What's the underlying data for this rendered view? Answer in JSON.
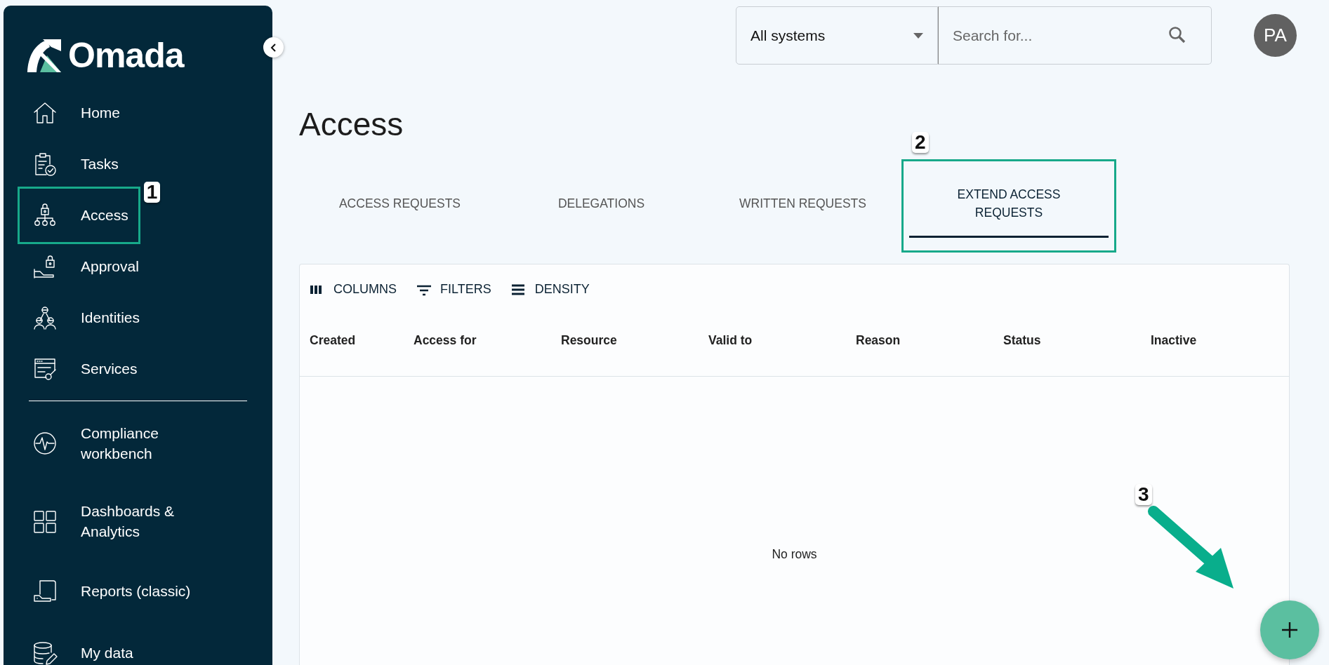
{
  "brand": {
    "name": "Omada"
  },
  "sidebar": {
    "groups": [
      {
        "items": [
          {
            "label": "Home",
            "highlighted": false
          },
          {
            "label": "Tasks",
            "highlighted": false
          },
          {
            "label": "Access",
            "highlighted": true,
            "callout": "1"
          },
          {
            "label": "Approval",
            "highlighted": false
          },
          {
            "label": "Identities",
            "highlighted": false
          },
          {
            "label": "Services",
            "highlighted": false
          }
        ]
      },
      {
        "items": [
          {
            "label": "Compliance workbench",
            "highlighted": false
          },
          {
            "label": "Dashboards & Analytics",
            "highlighted": false
          },
          {
            "label": "Reports (classic)",
            "highlighted": false
          },
          {
            "label": "My data",
            "highlighted": false
          }
        ]
      }
    ]
  },
  "top_bar": {
    "system_select": {
      "value": "All systems"
    },
    "search": {
      "placeholder": "Search for..."
    },
    "avatar": {
      "initials": "PA"
    }
  },
  "page": {
    "title": "Access"
  },
  "tabs": [
    {
      "label": "ACCESS REQUESTS",
      "selected": false,
      "highlighted": false
    },
    {
      "label": "DELEGATIONS",
      "selected": false,
      "highlighted": false
    },
    {
      "label": "WRITTEN REQUESTS",
      "selected": false,
      "highlighted": false
    },
    {
      "label": "EXTEND ACCESS REQUESTS",
      "selected": true,
      "highlighted": true,
      "callout": "2"
    }
  ],
  "table": {
    "toolbar": [
      {
        "label": "COLUMNS"
      },
      {
        "label": "FILTERS"
      },
      {
        "label": "DENSITY"
      }
    ],
    "columns": [
      "Created",
      "Access for",
      "Resource",
      "Valid to",
      "Reason",
      "Status",
      "Inactive"
    ],
    "empty_text": "No rows"
  },
  "fab": {
    "callout": "3"
  }
}
